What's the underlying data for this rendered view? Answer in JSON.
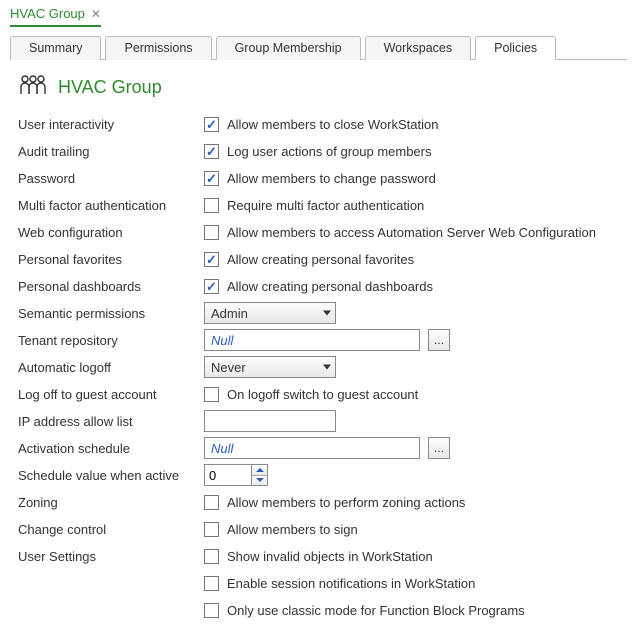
{
  "docTab": {
    "title": "HVAC Group"
  },
  "tabs": {
    "summary": "Summary",
    "permissions": "Permissions",
    "groupMembership": "Group Membership",
    "workspaces": "Workspaces",
    "policies": "Policies",
    "active": "policies"
  },
  "header": {
    "title": "HVAC Group"
  },
  "policies": {
    "userInteractivity": {
      "label": "User interactivity",
      "checked": true,
      "text": "Allow members to close WorkStation"
    },
    "auditTrailing": {
      "label": "Audit trailing",
      "checked": true,
      "text": "Log user actions of group members"
    },
    "password": {
      "label": "Password",
      "checked": true,
      "text": "Allow members to change password"
    },
    "mfa": {
      "label": "Multi factor authentication",
      "checked": false,
      "text": "Require multi factor authentication"
    },
    "webConfig": {
      "label": "Web configuration",
      "checked": false,
      "text": "Allow members to access Automation Server Web Configuration"
    },
    "personalFavorites": {
      "label": "Personal favorites",
      "checked": true,
      "text": "Allow creating personal favorites"
    },
    "personalDashboards": {
      "label": "Personal dashboards",
      "checked": true,
      "text": "Allow creating personal dashboards"
    },
    "semanticPermissions": {
      "label": "Semantic permissions",
      "value": "Admin"
    },
    "tenantRepository": {
      "label": "Tenant repository",
      "value": "Null",
      "browse": "..."
    },
    "automaticLogoff": {
      "label": "Automatic logoff",
      "value": "Never"
    },
    "logoffGuest": {
      "label": "Log off to guest account",
      "checked": false,
      "text": "On logoff switch to guest account"
    },
    "ipAllowList": {
      "label": "IP address allow list",
      "value": ""
    },
    "activationSchedule": {
      "label": "Activation schedule",
      "value": "Null",
      "browse": "..."
    },
    "scheduleValueActive": {
      "label": "Schedule value when active",
      "value": "0"
    },
    "zoning": {
      "label": "Zoning",
      "checked": false,
      "text": "Allow members to perform zoning actions"
    },
    "changeControl": {
      "label": "Change control",
      "checked": false,
      "text": "Allow members to sign"
    },
    "userSettings": {
      "label": "User Settings",
      "opt1": {
        "checked": false,
        "text": "Show invalid objects in WorkStation"
      },
      "opt2": {
        "checked": false,
        "text": "Enable session notifications in WorkStation"
      },
      "opt3": {
        "checked": false,
        "text": "Only use classic mode for Function Block Programs"
      }
    }
  }
}
